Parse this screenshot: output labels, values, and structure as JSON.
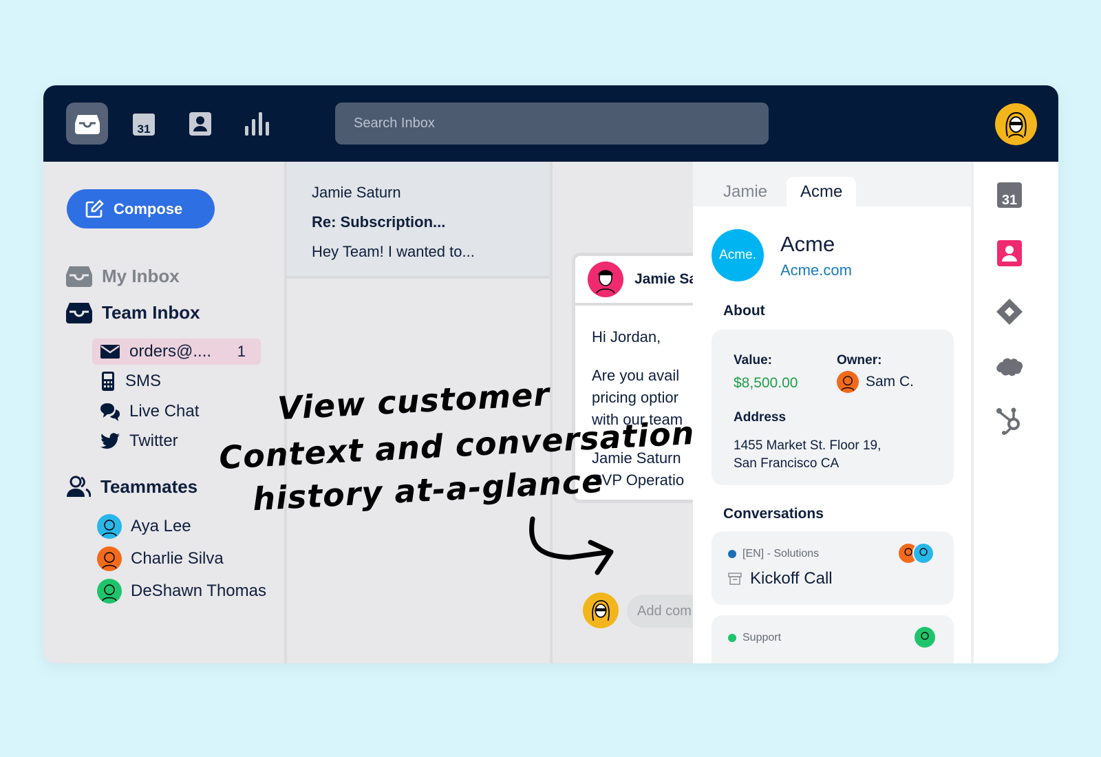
{
  "topbar": {
    "search_placeholder": "Search Inbox",
    "nav_icons": [
      "inbox-icon",
      "calendar-icon",
      "contacts-icon",
      "analytics-icon"
    ],
    "calendar_day": "31"
  },
  "sidebar": {
    "compose_label": "Compose",
    "my_inbox": "My Inbox",
    "team_inbox": "Team Inbox",
    "channels": [
      {
        "label": "orders@....",
        "count": "1",
        "icon": "envelope-icon"
      },
      {
        "label": "SMS",
        "icon": "phone-icon"
      },
      {
        "label": "Live Chat",
        "icon": "chat-icon"
      },
      {
        "label": "Twitter",
        "icon": "twitter-icon"
      }
    ],
    "teammates_label": "Teammates",
    "teammates": [
      {
        "name": "Aya Lee",
        "color": "#29b6e8"
      },
      {
        "name": "Charlie Silva",
        "color": "#f26a1b"
      },
      {
        "name": "DeShawn Thomas",
        "color": "#1ec46b"
      }
    ]
  },
  "message_list": {
    "sender": "Jamie Saturn",
    "subject": "Re: Subscription...",
    "preview": "Hey Team! I wanted to..."
  },
  "conversation": {
    "from": "Jamie Sa",
    "greeting": "Hi Jordan,",
    "body_lines": [
      "Are you avail",
      "pricing optior",
      "with our team"
    ],
    "signature_name": "Jamie Saturn",
    "signature_title": "SVP Operatio",
    "comment_placeholder": "Add com"
  },
  "annotation": {
    "line1": "View customer",
    "line2": "Context and conversation",
    "line3": "history at-a-glance"
  },
  "panel": {
    "tabs": [
      "Jamie",
      "Acme"
    ],
    "active_tab": "Acme",
    "logo_text": "Acme.",
    "company_name": "Acme",
    "company_link": "Acme.com",
    "about_title": "About",
    "value_label": "Value:",
    "value": "$8,500.00",
    "owner_label": "Owner:",
    "owner": "Sam C.",
    "address_label": "Address",
    "address_line1": "1455 Market St. Floor 19,",
    "address_line2": "San Francisco CA",
    "conversations_title": "Conversations",
    "conversations": [
      {
        "tag": "[EN] - Solutions",
        "subject": "Kickoff Call",
        "dot_color": "#1a6fb8"
      },
      {
        "tag": "Support",
        "subject": "",
        "dot_color": "#1ec46b"
      }
    ]
  },
  "rail": {
    "icons": [
      "calendar-icon",
      "contact-card-icon",
      "jira-icon",
      "salesforce-icon",
      "hubspot-icon"
    ],
    "calendar_day": "31"
  },
  "colors": {
    "topbar": "#031a3a",
    "compose": "#2f6fe4",
    "accent_pink": "#ef2a6f",
    "value_green": "#1e9e4a",
    "link_blue": "#1a7ab5"
  }
}
